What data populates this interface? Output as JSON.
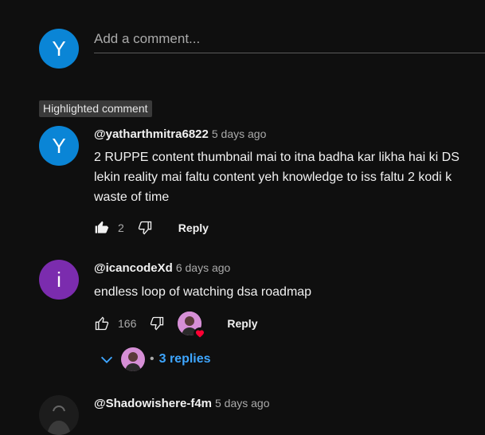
{
  "add_comment": {
    "avatar_letter": "Y",
    "placeholder": "Add a comment..."
  },
  "highlighted_label": "Highlighted comment",
  "comments": [
    {
      "avatar_letter": "Y",
      "avatar_color": "#0a85d6",
      "handle": "@yatharthmitra6822",
      "time": "5 days ago",
      "lines": [
        "2 RUPPE content thumbnail mai to itna badha kar likha hai ki DS",
        "lekin reality mai faltu content yeh knowledge to iss faltu 2 kodi k",
        "waste of time"
      ],
      "likes": "2",
      "reply_label": "Reply"
    },
    {
      "avatar_letter": "i",
      "avatar_color": "#7b2cae",
      "handle": "@icancodeXd",
      "time": "6 days ago",
      "lines": [
        "endless loop of watching dsa roadmap"
      ],
      "likes": "166",
      "reply_label": "Reply",
      "replies_label": "3 replies"
    },
    {
      "handle": "@Shadowishere-f4m",
      "time": "5 days ago"
    }
  ],
  "colors": {
    "background": "#0f0f0f",
    "link": "#3ea6ff",
    "heart": "#ff0033"
  }
}
